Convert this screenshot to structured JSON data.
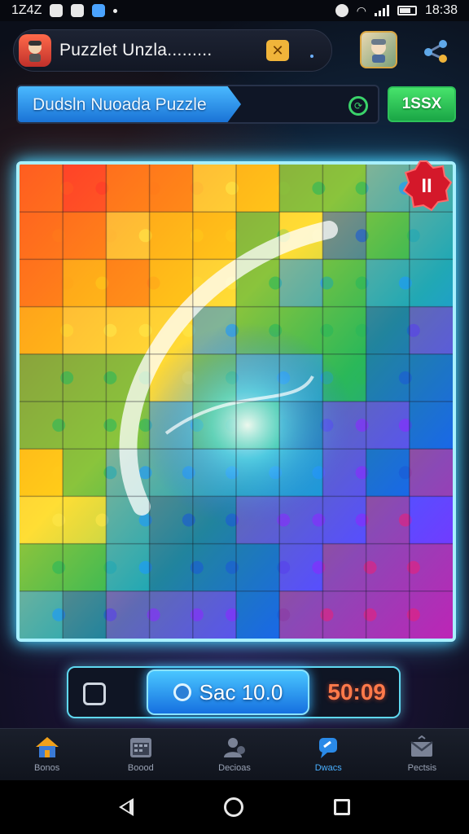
{
  "status_bar": {
    "time_left": "1Z4Z",
    "time_right": "18:38"
  },
  "header": {
    "title": "Puzzlet Unzla.........",
    "badge_glyph": "✕"
  },
  "level": {
    "label": "Dudsln Nuoada Puzzle",
    "progress": 0.62
  },
  "action_button": {
    "label": "1SSX"
  },
  "board": {
    "rows": 10,
    "cols": 10,
    "corner_badge": "II"
  },
  "controls": {
    "score_label": "Sac 10.0",
    "timer": "50:09"
  },
  "tabs": [
    {
      "label": "Bonos",
      "icon": "home-icon",
      "active": false
    },
    {
      "label": "Boood",
      "icon": "calendar-icon",
      "active": false
    },
    {
      "label": "Decioas",
      "icon": "people-icon",
      "active": false
    },
    {
      "label": "Dwacs",
      "icon": "chat-icon",
      "active": true
    },
    {
      "label": "Pectsis",
      "icon": "mail-icon",
      "active": false
    }
  ],
  "colors": {
    "accent": "#4ab9ff",
    "board_glow": "#4ad4ff",
    "timer": "#ff7a4a",
    "green": "#2ec25a"
  }
}
